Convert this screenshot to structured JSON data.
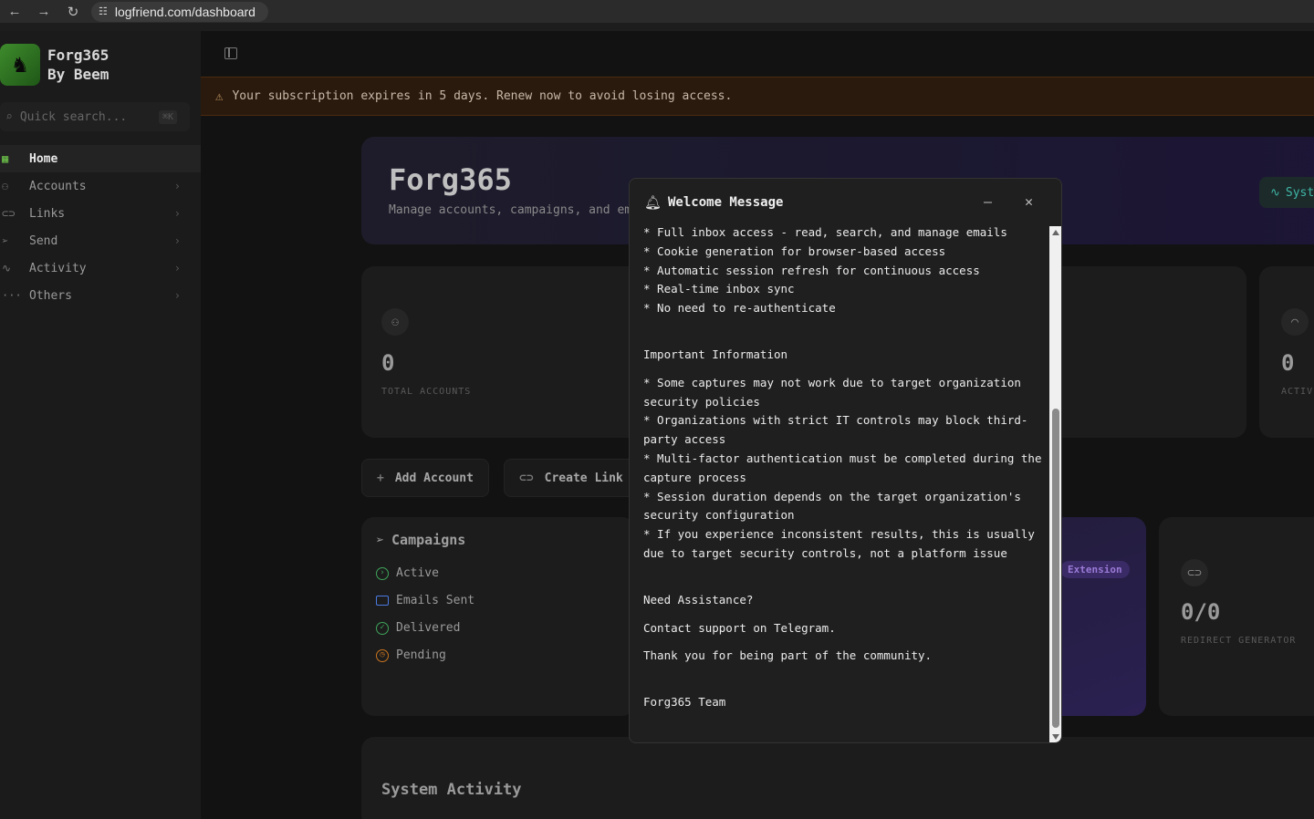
{
  "browser": {
    "url": "logfriend.com/dashboard"
  },
  "sidebar": {
    "brand_name": "Forg365",
    "brand_sub": "By Beem",
    "search_placeholder": "Quick search...",
    "search_shortcut": "⌘K",
    "items": [
      {
        "label": "Home",
        "icon": "grid-icon"
      },
      {
        "label": "Accounts",
        "icon": "users-icon"
      },
      {
        "label": "Links",
        "icon": "link-icon"
      },
      {
        "label": "Send",
        "icon": "send-icon"
      },
      {
        "label": "Activity",
        "icon": "activity-icon"
      },
      {
        "label": "Others",
        "icon": "more-icon"
      }
    ]
  },
  "banner": {
    "text": "Your subscription expires in 5 days. Renew now to avoid losing access."
  },
  "hero": {
    "title": "Forg365",
    "subtitle": "Manage accounts, campaigns, and em",
    "status": "Syst"
  },
  "stats": {
    "total_accounts": {
      "value": "0",
      "label": "TOTAL ACCOUNTS"
    },
    "active": {
      "value": "0",
      "label": "ACTIV"
    },
    "redirect": {
      "value": "0/0",
      "label": "REDIRECT GENERATOR"
    }
  },
  "actions": {
    "add_account": "Add Account",
    "create_link": "Create Link"
  },
  "campaigns": {
    "title": "Campaigns",
    "items": [
      "Active",
      "Emails Sent",
      "Delivered",
      "Pending"
    ]
  },
  "extension": {
    "label": "Extension"
  },
  "system_activity": {
    "title": "System Activity"
  },
  "modal": {
    "title": "Welcome Message",
    "lines": [
      "* Full inbox access - read, search, and manage emails",
      "* Cookie generation for browser-based access",
      "* Automatic session refresh for continuous access",
      "* Real-time inbox sync",
      "* No need to re-authenticate",
      "Important Information",
      "* Some captures may not work due to target organization security policies",
      "* Organizations with strict IT controls may block third-party access",
      "* Multi-factor authentication must be completed during the capture process",
      "* Session duration depends on the target organization's security configuration",
      "* If you experience inconsistent results, this is usually due to target security controls, not a platform issue",
      "Need Assistance?",
      "Contact support on Telegram.",
      "Thank you for being part of the community.",
      "Forg365 Team"
    ]
  },
  "colors": {
    "accent_green": "#6cc04a",
    "banner_bg": "#2a1a0e",
    "hero_purple": "#1d1536",
    "extension_purple": "#2b2052"
  }
}
